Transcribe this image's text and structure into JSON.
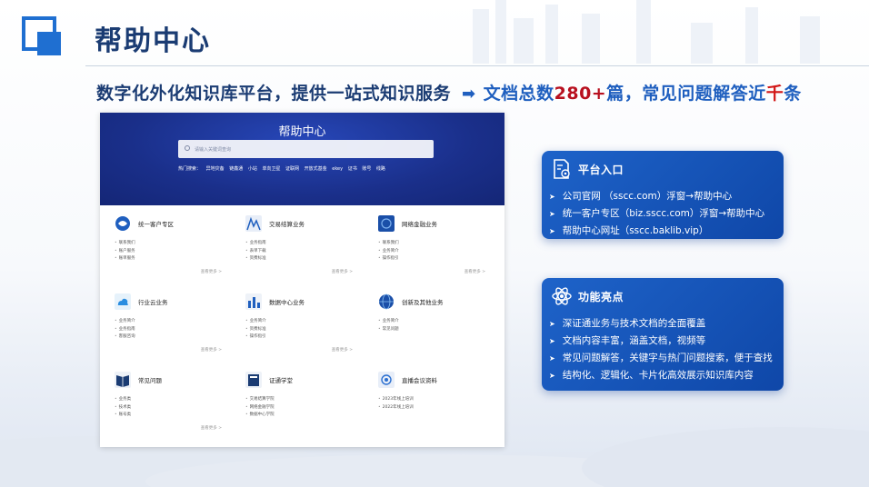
{
  "slide": {
    "title": "帮助中心",
    "headline": {
      "lead": "数字化外化知识库平台，提供一站式知识服务",
      "arrow": "➡",
      "stat_a": "文档总数",
      "stat_num": "280+",
      "stat_b": "篇，常见问题解答近",
      "stat_red": "千",
      "stat_c": "条"
    }
  },
  "screenshot": {
    "hero_title": "帮助中心",
    "search_placeholder": "请输入关键词查询",
    "hot_label": "热门搜索：",
    "hot_terms": [
      "异地灾备",
      "链鑫通",
      "小站",
      "单向卫星",
      "证联网",
      "开放式基金",
      "ekey",
      "证书",
      "账号",
      "线路"
    ],
    "cards": [
      {
        "title": "统一客户专区",
        "links": [
          "联系我们",
          "账户服务",
          "账单服务"
        ],
        "more": "查看更多 >"
      },
      {
        "title": "交易结算业务",
        "links": [
          "业务指南",
          "表单下载",
          "资费标准"
        ],
        "more": "查看更多 >"
      },
      {
        "title": "网络金融业务",
        "links": [
          "联系我们",
          "业务简介",
          "操作指引"
        ],
        "more": "查看更多 >"
      },
      {
        "title": "行业云业务",
        "links": [
          "业务简介",
          "业务指南",
          "客服咨询"
        ],
        "more": "查看更多 >"
      },
      {
        "title": "数据中心业务",
        "links": [
          "业务简介",
          "资费标准",
          "操作指引"
        ],
        "more": "查看更多 >"
      },
      {
        "title": "创新及其他业务",
        "links": [
          "业务简介",
          "常见问题"
        ],
        "more": ""
      },
      {
        "title": "常见问题",
        "links": [
          "业务类",
          "技术类",
          "账号类"
        ],
        "more": "查看更多 >"
      },
      {
        "title": "证通学堂",
        "links": [
          "交易结算学院",
          "网络金融学院",
          "数据中心学院"
        ],
        "more": ""
      },
      {
        "title": "直播会议资料",
        "links": [
          "2023年线上培训",
          "2022年线上培训"
        ],
        "more": ""
      }
    ]
  },
  "panel_entry": {
    "title": "平台入口",
    "items": [
      "公司官网 （sscc.com）浮窗→帮助中心",
      "统一客户专区（biz.sscc.com）浮窗→帮助中心",
      "帮助中心网址（sscc.baklib.vip）"
    ]
  },
  "panel_features": {
    "title": "功能亮点",
    "items": [
      "深证通业务与技术文档的全面覆盖",
      "文档内容丰富，涵盖文档，视频等",
      "常见问题解答，关键字与热门问题搜索，便于查找",
      "结构化、逻辑化、卡片化高效展示知识库内容"
    ]
  },
  "colors": {
    "brand_blue": "#1f6fd1",
    "title_navy": "#1b3c73",
    "accent_red": "#d21515",
    "panel_blue": "#1a58bf"
  }
}
